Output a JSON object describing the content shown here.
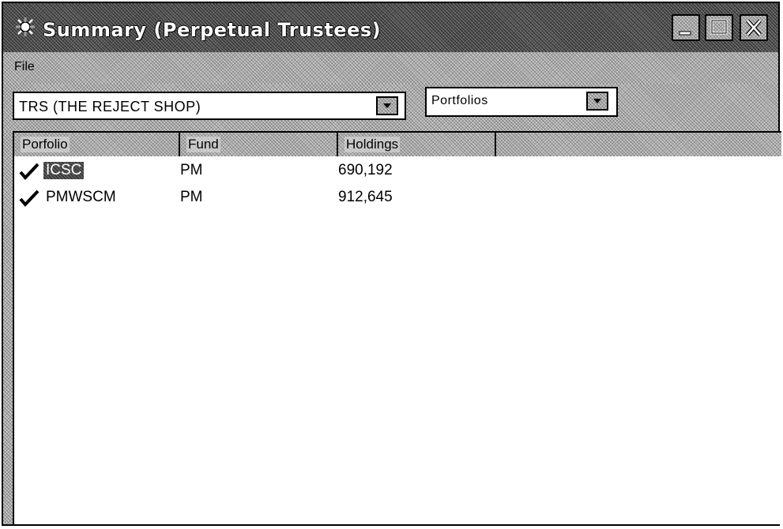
{
  "window": {
    "title": "Summary (Perpetual Trustees)",
    "icon": "app-icon",
    "controls": [
      "minimize-icon",
      "maximize-icon",
      "close-icon"
    ]
  },
  "menu": {
    "file_label": "File"
  },
  "toolbar": {
    "stock_combo_value": "TRS (THE REJECT SHOP)",
    "view_combo_value": "Portfolios"
  },
  "list": {
    "columns": {
      "portfolio": "Porfolio",
      "fund": "Fund",
      "holdings": "Holdings"
    },
    "rows": [
      {
        "portfolio": "ICSC",
        "fund": "PM",
        "holdings": "690,192",
        "checked": true,
        "selected": true
      },
      {
        "portfolio": "PMWSCM",
        "fund": "PM",
        "holdings": "912,645",
        "checked": true,
        "selected": false
      }
    ]
  }
}
